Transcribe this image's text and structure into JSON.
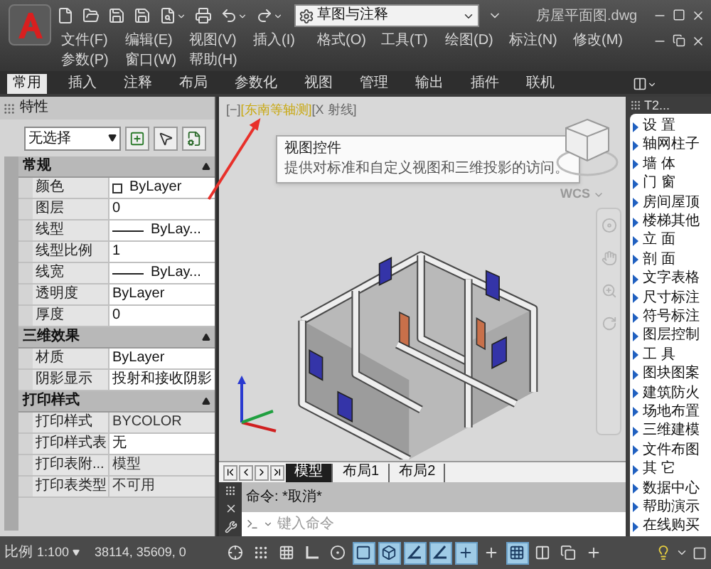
{
  "window": {
    "title": "房屋平面图.dwg"
  },
  "quick_access": {
    "workspace": "草图与注释"
  },
  "menu_bar": {
    "rows": [
      [
        "文件(F)",
        "编辑(E)",
        "视图(V)",
        "插入(I)",
        "格式(O)",
        "工具(T)",
        "绘图(D)",
        "标注(N)",
        "修改(M)"
      ],
      [
        "参数(P)",
        "窗口(W)",
        "帮助(H)"
      ]
    ]
  },
  "ribbon_tabs": [
    {
      "label": "常用",
      "selected": true
    },
    {
      "label": "插入",
      "selected": false
    },
    {
      "label": "注释",
      "selected": false
    },
    {
      "label": "布局",
      "selected": false
    },
    {
      "label": "参数化",
      "selected": false
    },
    {
      "label": "视图",
      "selected": false
    },
    {
      "label": "管理",
      "selected": false
    },
    {
      "label": "输出",
      "selected": false
    },
    {
      "label": "插件",
      "selected": false
    },
    {
      "label": "联机",
      "selected": false
    }
  ],
  "properties": {
    "title": "特性",
    "selection": "无选择",
    "sections": [
      {
        "title": "常规",
        "expanded": true,
        "rows": [
          {
            "label": "颜色",
            "value": "ByLayer",
            "kind": "color",
            "disabled": false
          },
          {
            "label": "图层",
            "value": "0",
            "kind": "text",
            "disabled": false
          },
          {
            "label": "线型",
            "value": "ByLay...",
            "kind": "line",
            "disabled": false
          },
          {
            "label": "线型比例",
            "value": "1",
            "kind": "text",
            "disabled": false
          },
          {
            "label": "线宽",
            "value": "ByLay...",
            "kind": "line",
            "disabled": false
          },
          {
            "label": "透明度",
            "value": "ByLayer",
            "kind": "text",
            "disabled": false
          },
          {
            "label": "厚度",
            "value": "0",
            "kind": "text",
            "disabled": false
          }
        ]
      },
      {
        "title": "三维效果",
        "expanded": true,
        "rows": [
          {
            "label": "材质",
            "value": "ByLayer",
            "kind": "text",
            "disabled": false
          },
          {
            "label": "阴影显示",
            "value": "投射和接收阴影",
            "kind": "text",
            "disabled": false
          }
        ]
      },
      {
        "title": "打印样式",
        "expanded": true,
        "rows": [
          {
            "label": "打印样式",
            "value": "BYCOLOR",
            "kind": "text",
            "disabled": true
          },
          {
            "label": "打印样式表",
            "value": "无",
            "kind": "text",
            "disabled": false
          },
          {
            "label": "打印表附...",
            "value": "模型",
            "kind": "text",
            "disabled": true
          },
          {
            "label": "打印表类型",
            "value": "不可用",
            "kind": "text",
            "disabled": true
          }
        ]
      }
    ]
  },
  "viewport": {
    "controls": [
      {
        "label": "[−]",
        "selected": false
      },
      {
        "label": "[东南等轴测]",
        "selected": true
      },
      {
        "label": "[X 射线]",
        "selected": false
      }
    ],
    "ucs": "WCS",
    "tooltip": {
      "title": "视图控件",
      "text": "提供对标准和自定义视图和三维投影的访问。"
    }
  },
  "layout_tabs": [
    {
      "label": "模型",
      "selected": true
    },
    {
      "label": "布局1",
      "selected": false
    },
    {
      "label": "布局2",
      "selected": false
    }
  ],
  "command": {
    "history": "命令: *取消*",
    "placeholder": "键入命令"
  },
  "tool_palette": {
    "title": "T2...",
    "items": [
      "设 置",
      "轴网柱子",
      "墙 体",
      "门 窗",
      "房间屋顶",
      "楼梯其他",
      "立 面",
      "剖 面",
      "文字表格",
      "尺寸标注",
      "符号标注",
      "图层控制",
      "工 具",
      "图块图案",
      "建筑防火",
      "场地布置",
      "三维建模",
      "文件布图",
      "其 它",
      "数据中心",
      "帮助演示",
      "在线购买"
    ]
  },
  "status_bar": {
    "scale_label": "比例",
    "scale": "1:100",
    "coordinates": "38114, 35609, 0",
    "toggles": [
      {
        "on": false
      },
      {
        "on": false
      },
      {
        "on": false
      },
      {
        "on": false
      },
      {
        "on": false
      },
      {
        "on": true
      },
      {
        "on": true
      },
      {
        "on": true
      },
      {
        "on": true
      },
      {
        "on": true
      },
      {
        "on": false
      },
      {
        "on": true
      },
      {
        "on": false
      },
      {
        "on": false
      },
      {
        "on": false
      }
    ]
  }
}
